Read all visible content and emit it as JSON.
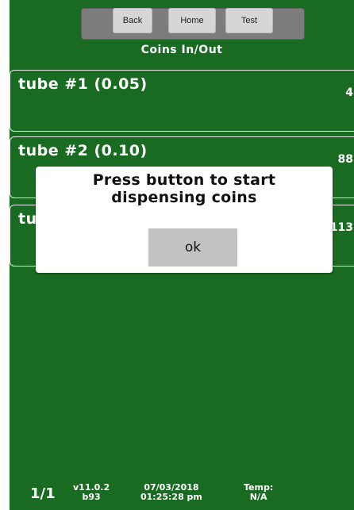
{
  "nav": {
    "back_label": "Back",
    "home_label": "Home",
    "test_label": "Test"
  },
  "screen_title": "Coins In/Out",
  "tubes": [
    {
      "label": "tube #1 (0.05)",
      "count": "4"
    },
    {
      "label": "tube #2 (0.10)",
      "count": "88"
    },
    {
      "label": "tube #3",
      "count": "113"
    }
  ],
  "tube3_visible_label": "tu",
  "dialog": {
    "message_line1": "Press button to start",
    "message_line2": "dispensing coins",
    "ok_label": "ok"
  },
  "status_bar": {
    "page": "1/1",
    "version": "v11.0.2",
    "build": "b93",
    "date": "07/03/2018",
    "time": "01:25:28 pm",
    "temp_label": "Temp:",
    "temp_value": "N/A"
  },
  "colors": {
    "background": "#1a6b22",
    "panel_border": "#e8e8e8",
    "dialog": "#ffffff",
    "ok_button": "#c2c2c2"
  }
}
